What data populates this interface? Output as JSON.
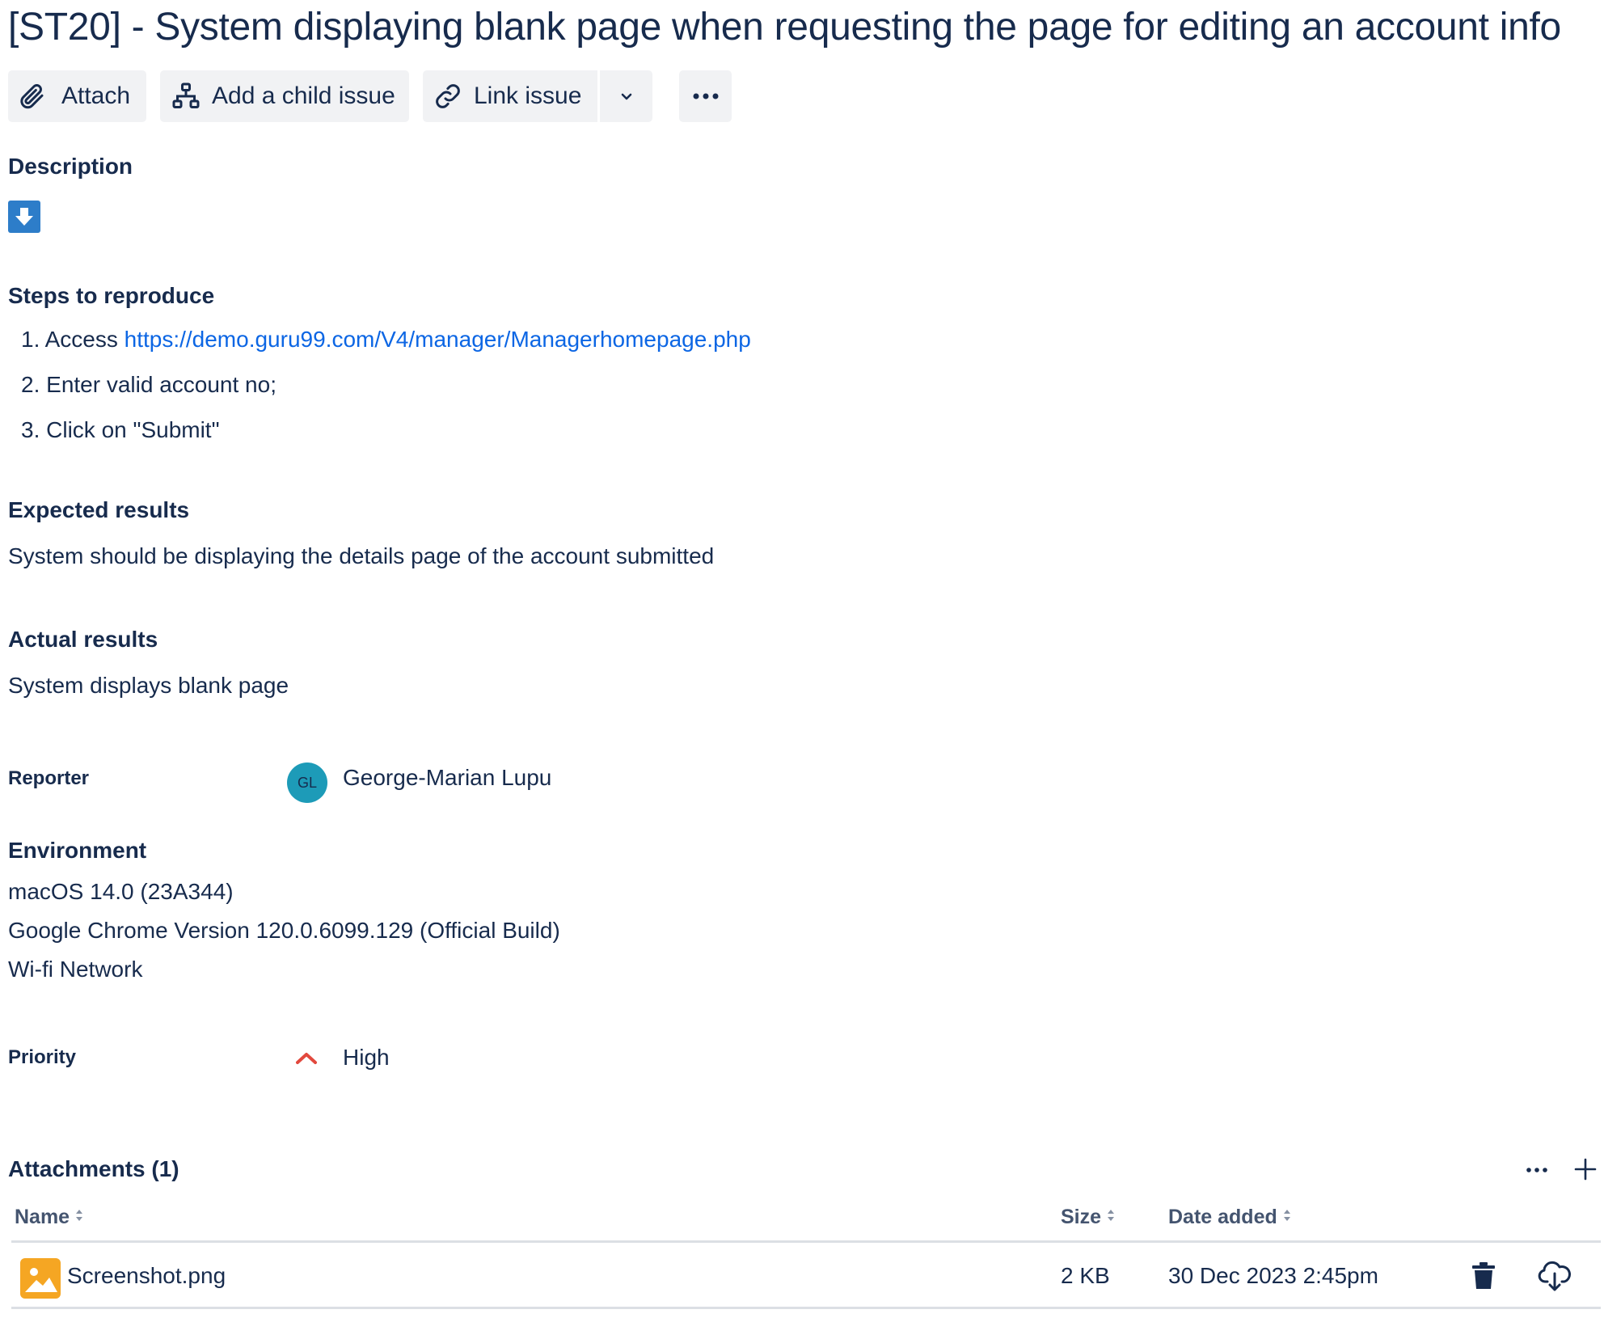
{
  "issue": {
    "title": "[ST20] - System displaying blank page when requesting the page for editing an account info"
  },
  "toolbar": {
    "attach_label": "Attach",
    "add_child_label": "Add a child issue",
    "link_issue_label": "Link issue"
  },
  "description": {
    "heading": "Description",
    "steps_heading": "Steps to reproduce",
    "steps": [
      {
        "number": "1.",
        "text": "Access ",
        "link": "https://demo.guru99.com/V4/manager/Managerhomepage.php"
      },
      {
        "number": "2.",
        "text": "Enter valid account no;"
      },
      {
        "number": "3.",
        "text": "Click on \"Submit\""
      }
    ],
    "expected_heading": "Expected results",
    "expected_text": "System should be displaying the details page of the account submitted",
    "actual_heading": "Actual results",
    "actual_text": "System displays blank page"
  },
  "reporter": {
    "label": "Reporter",
    "initials": "GL",
    "name": "George-Marian Lupu",
    "avatar_color": "#1d9bb8"
  },
  "environment": {
    "heading": "Environment",
    "lines": [
      "macOS 14.0 (23A344)",
      "Google Chrome Version 120.0.6099.129 (Official Build)",
      "Wi-fi Network"
    ]
  },
  "priority": {
    "label": "Priority",
    "value": "High",
    "color": "#e2483d"
  },
  "attachments": {
    "heading": "Attachments (1)",
    "columns": {
      "name": "Name",
      "size": "Size",
      "date": "Date added"
    },
    "rows": [
      {
        "name": "Screenshot.png",
        "size": "2 KB",
        "date": "30 Dec 2023 2:45pm",
        "icon": "image-file-icon"
      }
    ]
  },
  "colors": {
    "text": "#172b4d",
    "link": "#0c66e4",
    "button_bg": "#f1f2f4",
    "download_icon": "#2d7dc9",
    "image_icon": "#f5a623"
  }
}
